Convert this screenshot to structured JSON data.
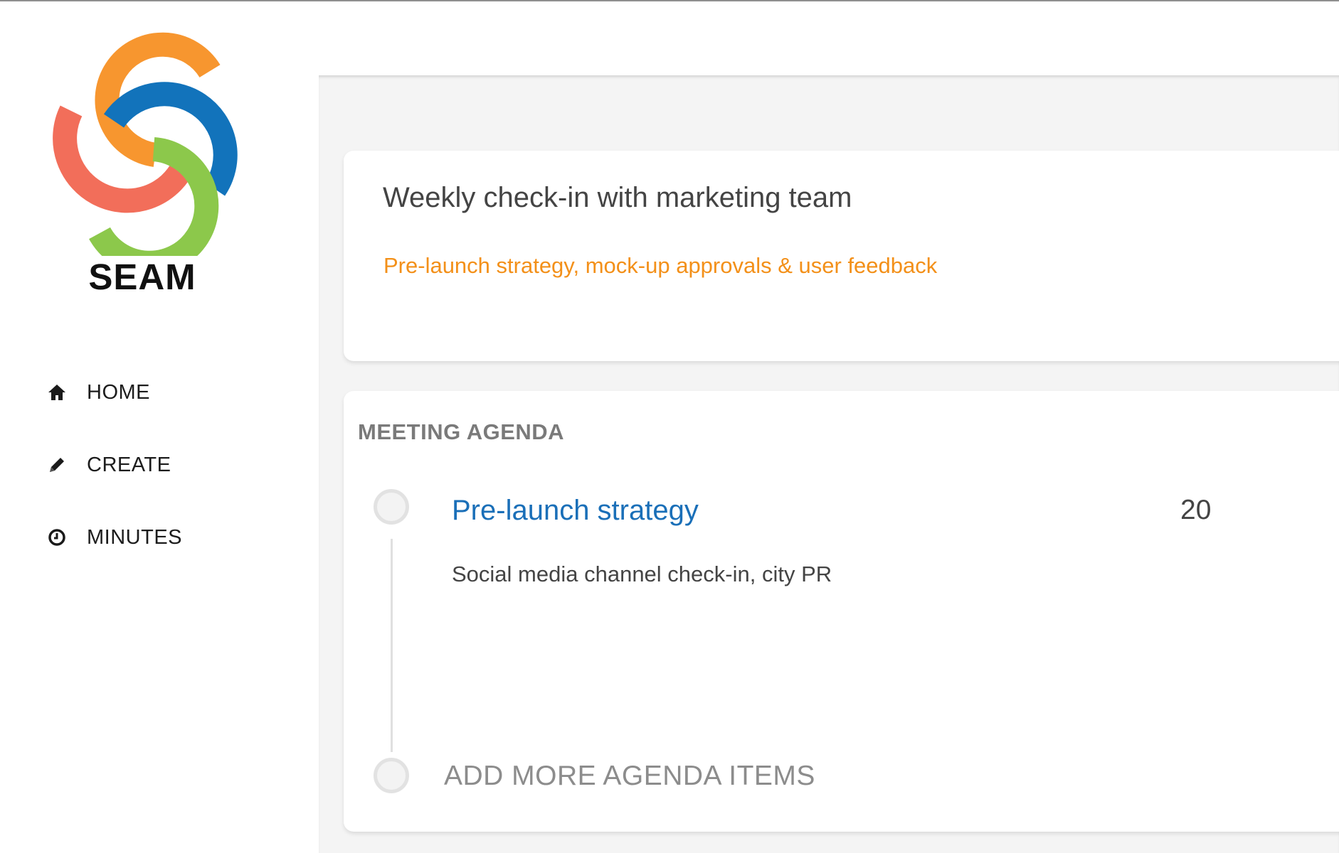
{
  "app": {
    "brand": "SEAM",
    "logo_colors": [
      "#f7962f",
      "#1273bb",
      "#f26e5a",
      "#8cc84b"
    ]
  },
  "sidebar": {
    "items": [
      {
        "label": "HOME",
        "icon": "home-icon"
      },
      {
        "label": "CREATE",
        "icon": "pencil-icon"
      },
      {
        "label": "MINUTES",
        "icon": "clock-icon"
      }
    ]
  },
  "meeting": {
    "title": "Weekly check-in with marketing team",
    "subtitle": "Pre-launch strategy, mock-up approvals & user feedback"
  },
  "agenda": {
    "heading": "MEETING AGENDA",
    "items": [
      {
        "title": "Pre-launch strategy",
        "duration": "20",
        "description": "Social media channel check-in, city PR"
      }
    ],
    "add_more_label": "ADD MORE AGENDA ITEMS"
  },
  "colors": {
    "accent_orange": "#f39019",
    "link_blue": "#1a6fb8",
    "background": "#f4f4f4"
  }
}
